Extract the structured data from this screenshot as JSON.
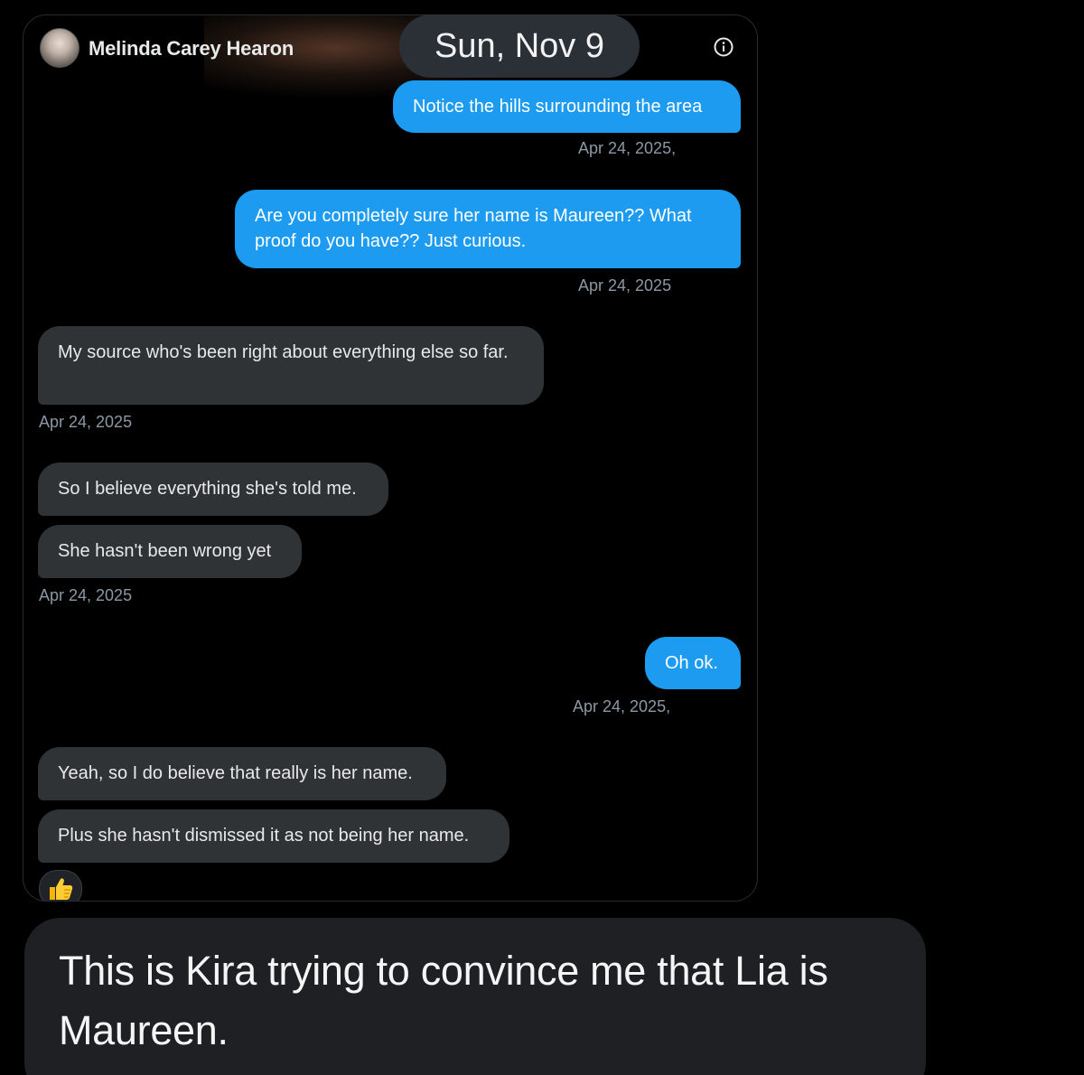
{
  "header": {
    "contact_name": "Melinda Carey Hearon",
    "date_pill": "Sun, Nov 9",
    "info_icon": "info-circle-icon"
  },
  "messages": [
    {
      "direction": "outgoing",
      "text": "Notice the hills surrounding the area",
      "timestamp": "Apr 24, 2025,"
    },
    {
      "direction": "outgoing",
      "text": "Are you completely sure her name is Maureen?? What proof do you have?? Just curious.",
      "timestamp": "Apr 24, 2025"
    },
    {
      "direction": "incoming",
      "text": "My source who's been right about everything else so far.",
      "timestamp": "Apr 24, 2025"
    },
    {
      "direction": "incoming",
      "text": "So I believe everything she's told me."
    },
    {
      "direction": "incoming",
      "text": "She hasn't been wrong yet",
      "timestamp": "Apr 24, 2025"
    },
    {
      "direction": "outgoing",
      "text": "Oh ok.",
      "timestamp": "Apr 24, 2025,"
    },
    {
      "direction": "incoming",
      "text": "Yeah, so I do believe that really is her name."
    },
    {
      "direction": "incoming",
      "text": "Plus she hasn't dismissed it as not being her name."
    }
  ],
  "reaction": {
    "icon": "thumbs-up-icon"
  },
  "caption": {
    "text": "This is Kira trying to convince me that Lia is Maureen."
  },
  "colors": {
    "outgoing_bubble": "#1d9bf0",
    "incoming_bubble": "#2f3336",
    "background": "#000000",
    "caption_box": "#1f2024"
  }
}
